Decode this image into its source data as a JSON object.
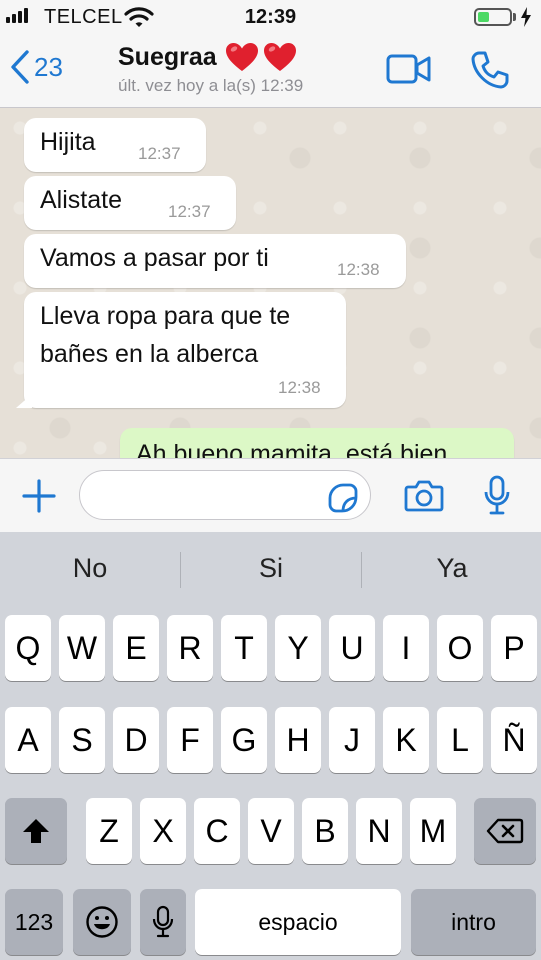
{
  "status_bar": {
    "carrier": "TELCEL",
    "time": "12:39",
    "battery_level": 0.35,
    "battery_color": "#4cd964"
  },
  "header": {
    "back_count": "23",
    "contact_name": "Suegraa",
    "contact_emoji": "heart-icon heart-icon",
    "last_seen": "últ. vez hoy a la(s) 12:39",
    "accent_color": "#1f78d1"
  },
  "messages": [
    {
      "direction": "in",
      "text": "Hijita",
      "time": "12:37"
    },
    {
      "direction": "in",
      "text": "Alistate",
      "time": "12:37"
    },
    {
      "direction": "in",
      "text": "Vamos a pasar por ti",
      "time": "12:38"
    },
    {
      "direction": "in",
      "text": "Lleva ropa para que te",
      "text2": "bañes en la alberca",
      "time": "12:38"
    },
    {
      "direction": "out",
      "text": "Ah bueno mamita, está bien"
    }
  ],
  "input": {
    "value": "",
    "placeholder": ""
  },
  "keyboard": {
    "suggestions": [
      "No",
      "Si",
      "Ya"
    ],
    "row1": [
      "Q",
      "W",
      "E",
      "R",
      "T",
      "Y",
      "U",
      "I",
      "O",
      "P"
    ],
    "row2": [
      "A",
      "S",
      "D",
      "F",
      "G",
      "H",
      "J",
      "K",
      "L",
      "Ñ"
    ],
    "row3": [
      "Z",
      "X",
      "C",
      "V",
      "B",
      "N",
      "M"
    ],
    "numbers_label": "123",
    "space_label": "espacio",
    "return_label": "intro"
  }
}
